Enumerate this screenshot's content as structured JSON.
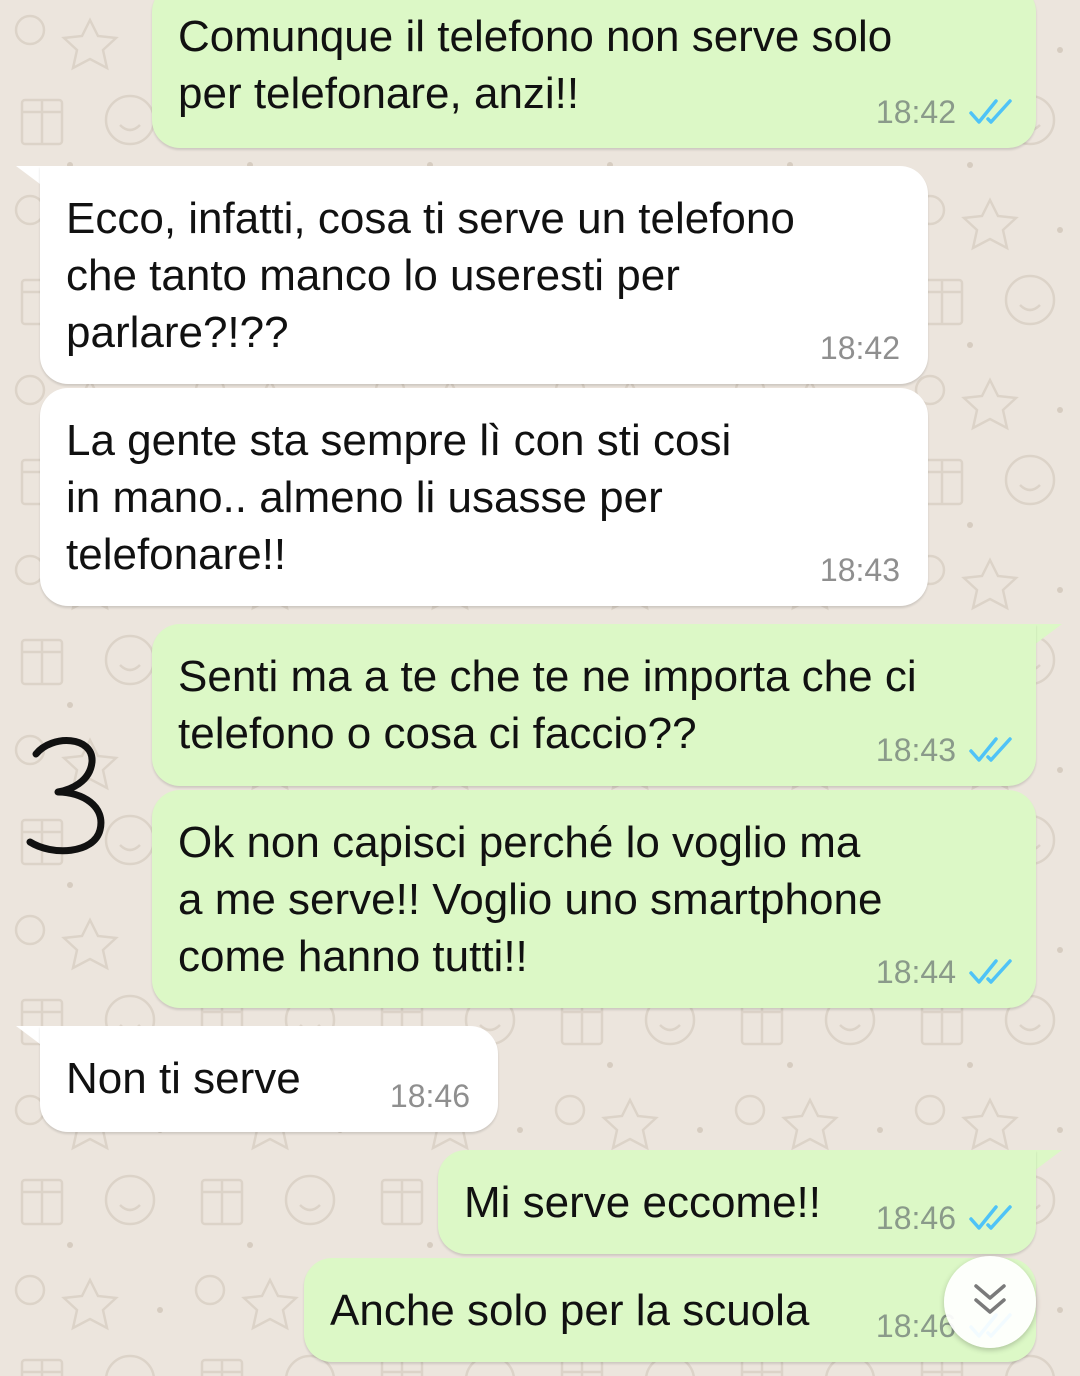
{
  "chat": {
    "messages": [
      {
        "direction": "out",
        "text": "Comunque il telefono non serve solo\nper telefonare, anzi!!",
        "time": "18:42",
        "status": "read"
      },
      {
        "direction": "in",
        "text": "Ecco, infatti, cosa ti serve un telefono\nche tanto manco lo useresti per\nparlare?!??",
        "time": "18:42"
      },
      {
        "direction": "in",
        "text": "La gente sta sempre lì con sti cosi\nin mano.. almeno li usasse per\ntelefonare!!",
        "time": "18:43"
      },
      {
        "direction": "out",
        "text": "Senti ma a te che te ne importa che ci\ntelefono o cosa ci faccio??",
        "time": "18:43",
        "status": "read"
      },
      {
        "direction": "out",
        "text": "Ok non capisci perché lo voglio ma\na me serve!! Voglio uno smartphone\ncome hanno tutti!!",
        "time": "18:44",
        "status": "read"
      },
      {
        "direction": "in",
        "text": "Non ti serve",
        "time": "18:46"
      },
      {
        "direction": "out",
        "text": "Mi serve eccome!!",
        "time": "18:46",
        "status": "read"
      },
      {
        "direction": "out",
        "text": "Anche solo per la scuola",
        "time": "18:46",
        "status": "read"
      }
    ],
    "annotation": "3",
    "scroll_button_icon": "double-chevron-down-icon"
  },
  "colors": {
    "outgoing_bubble": "#dcf8c6",
    "incoming_bubble": "#ffffff",
    "wallpaper": "#ece5dd",
    "read_tick": "#4fc3f7"
  }
}
